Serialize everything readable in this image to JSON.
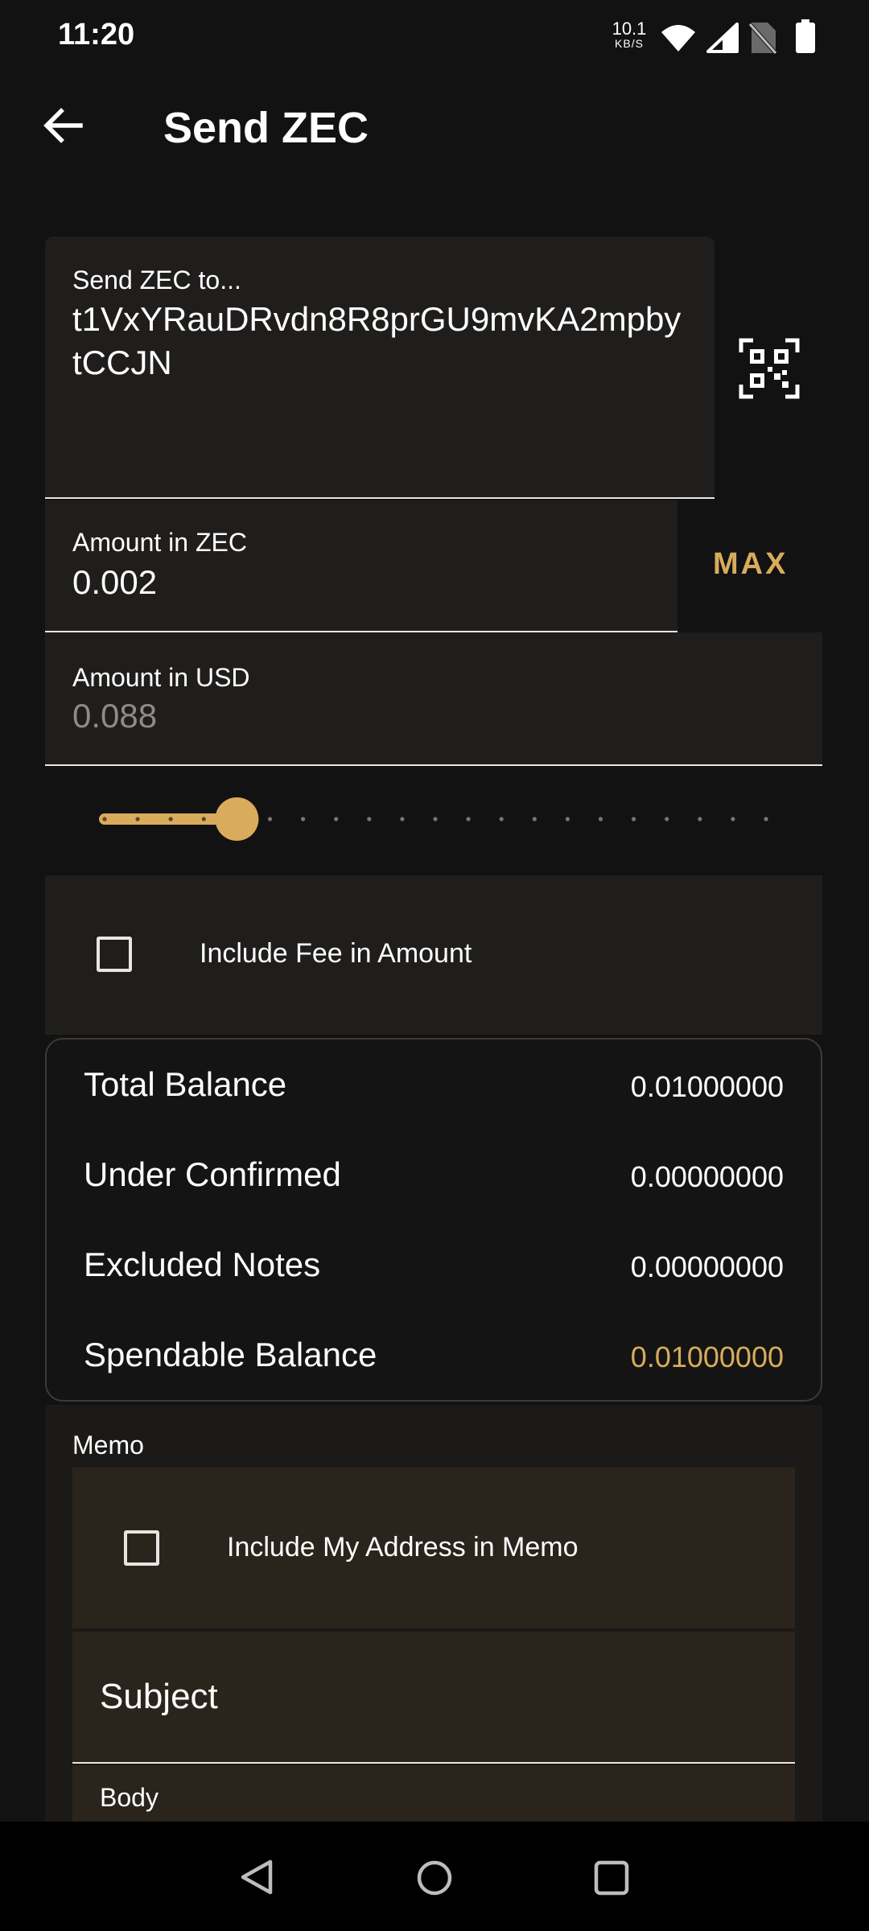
{
  "status_bar": {
    "time": "11:20",
    "net_speed_value": "10.1",
    "net_speed_unit": "KB/S",
    "icons": [
      "wifi-icon",
      "signal-icon",
      "no-sim-icon",
      "battery-icon"
    ]
  },
  "app_bar": {
    "title": "Send ZEC",
    "back_icon": "arrow-back-icon"
  },
  "form": {
    "address_label": "Send ZEC to...",
    "address_value": "t1VxYRauDRvdn8R8prGU9mvKA2mpbytCCJN",
    "amount_zec_label": "Amount in ZEC",
    "amount_zec_value": "0.002",
    "max_label": "MAX",
    "amount_usd_label": "Amount in USD",
    "amount_usd_value": "0.088",
    "slider_percent": 20,
    "include_fee_label": "Include Fee in Amount",
    "include_fee_checked": false
  },
  "balance": {
    "rows": [
      {
        "label": "Total Balance",
        "value": "0.01000000"
      },
      {
        "label": "Under Confirmed",
        "value": "0.00000000"
      },
      {
        "label": "Excluded Notes",
        "value": "0.00000000"
      },
      {
        "label": "Spendable Balance",
        "value": "0.01000000"
      }
    ]
  },
  "memo": {
    "label": "Memo",
    "include_address_label": "Include My Address in Memo",
    "include_address_checked": false,
    "subject_label": "Subject",
    "body_label": "Body"
  },
  "colors": {
    "background": "#121212",
    "accent": "#d8ac5c",
    "field": "#201e1c"
  }
}
